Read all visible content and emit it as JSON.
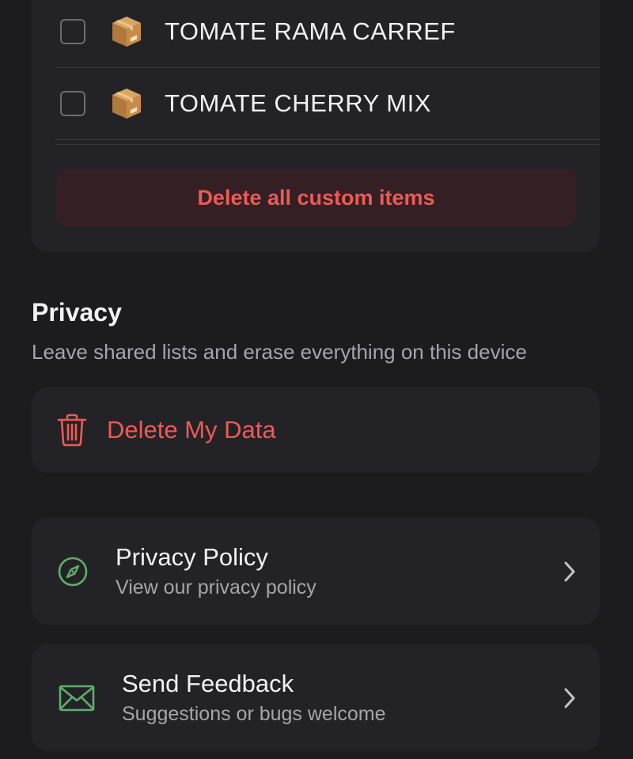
{
  "custom_items": {
    "items": [
      {
        "label": "TOMATE RAMA CARREF",
        "icon": "package-icon",
        "checked": false
      },
      {
        "label": "TOMATE CHERRY MIX",
        "icon": "package-icon",
        "checked": false
      }
    ],
    "delete_all_label": "Delete all custom items"
  },
  "privacy": {
    "title": "Privacy",
    "subtitle": "Leave shared lists and erase everything on this device",
    "delete_label": "Delete My Data",
    "delete_icon": "trash-icon"
  },
  "links": {
    "policy": {
      "title": "Privacy Policy",
      "subtitle": "View our privacy policy",
      "icon": "compass-icon"
    },
    "feedback": {
      "title": "Send Feedback",
      "subtitle": "Suggestions or bugs welcome",
      "icon": "envelope-icon"
    }
  },
  "colors": {
    "background": "#1c1c1f",
    "card": "#232327",
    "destructive": "#ee5a54",
    "destructive_bg": "#342024",
    "accent_green": "#5fae6b",
    "secondary_text": "#a5a5aa"
  }
}
